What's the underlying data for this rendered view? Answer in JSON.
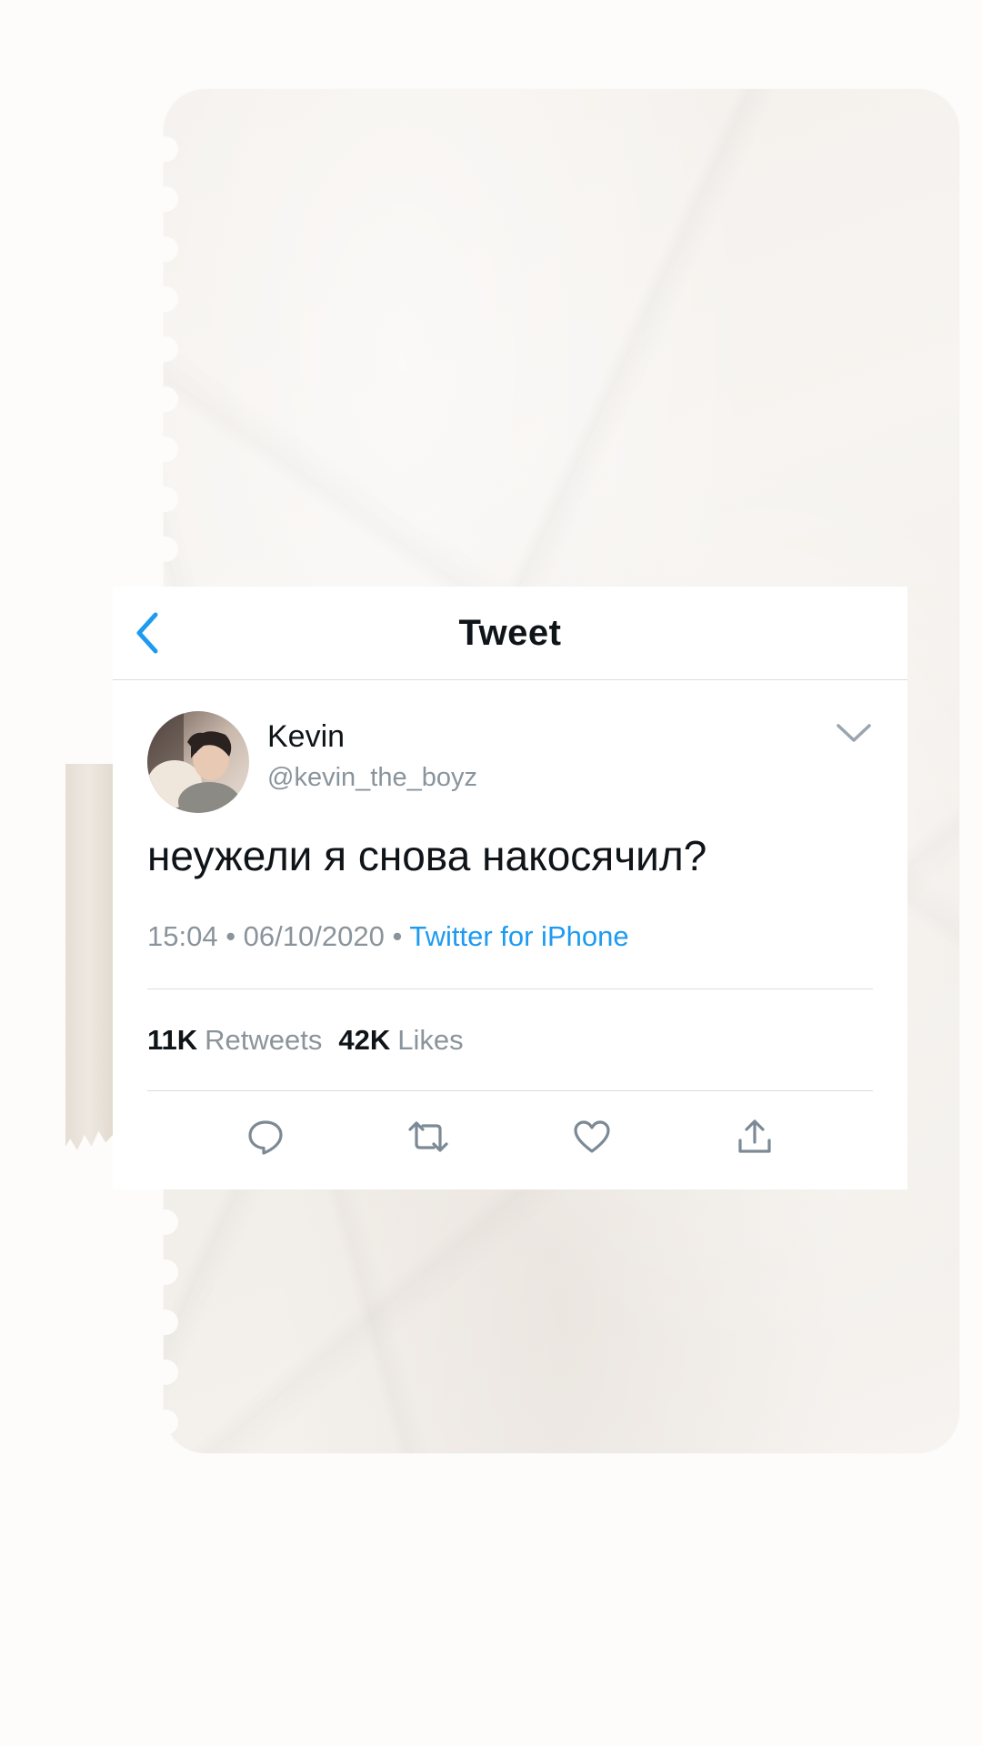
{
  "header": {
    "title": "Tweet",
    "back_icon": "chevron-left-icon"
  },
  "author": {
    "name": "Kevin",
    "handle": "@kevin_the_boyz",
    "avatar": "user-avatar-photo"
  },
  "tweet": {
    "text": "неужели я снова накосячил?",
    "time": "15:04",
    "separator": "•",
    "date": "06/10/2020",
    "source": "Twitter for iPhone"
  },
  "stats": {
    "retweets_count": "11K",
    "retweets_label": "Retweets",
    "likes_count": "42K",
    "likes_label": "Likes"
  },
  "actions": [
    {
      "name": "reply",
      "icon": "reply-icon"
    },
    {
      "name": "retweet",
      "icon": "retweet-icon"
    },
    {
      "name": "like",
      "icon": "heart-icon"
    },
    {
      "name": "share",
      "icon": "share-icon"
    }
  ],
  "colors": {
    "accent": "#1d9bf0",
    "text_primary": "#0f1419",
    "text_secondary": "#8a949c",
    "divider": "#d9dde0",
    "icon": "#7d8a95"
  }
}
